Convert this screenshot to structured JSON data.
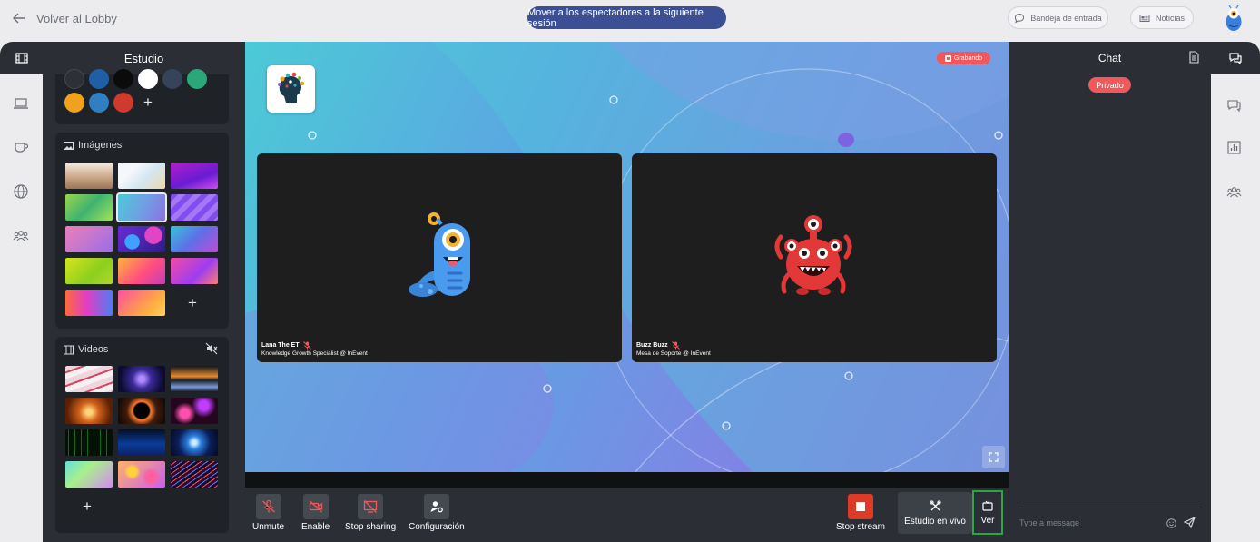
{
  "header": {
    "back_label": "Volver al Lobby",
    "move_button": "Mover a los espectadores a la siguiente sesión",
    "inbox": "Bandeja de entrada",
    "news": "Noticias"
  },
  "studio": {
    "title": "Estudio",
    "colors": [
      "#2d3035",
      "#1f5fa6",
      "#0b0b0b",
      "#ffffff",
      "#35445a",
      "#2aa87a",
      "#f1a11c",
      "#2f7fc2",
      "#cf3a2c"
    ],
    "images_title": "Imágenes",
    "videos_title": "Videos"
  },
  "stage": {
    "recording": "Grabando",
    "participants": [
      {
        "name": "Lana The ET",
        "role": "Knowledge Growth Specialist @ InEvent"
      },
      {
        "name": "Buzz Buzz",
        "role": "Mesa de Soporte @ InEvent"
      }
    ]
  },
  "controls": {
    "unmute": "Unmute",
    "enable": "Enable",
    "stop_sharing": "Stop sharing",
    "config": "Configuración",
    "stop_stream": "Stop stream",
    "live_studio": "Estudio en vivo",
    "ver": "Ver"
  },
  "chat": {
    "title": "Chat",
    "private": "Privado",
    "placeholder": "Type a message"
  }
}
